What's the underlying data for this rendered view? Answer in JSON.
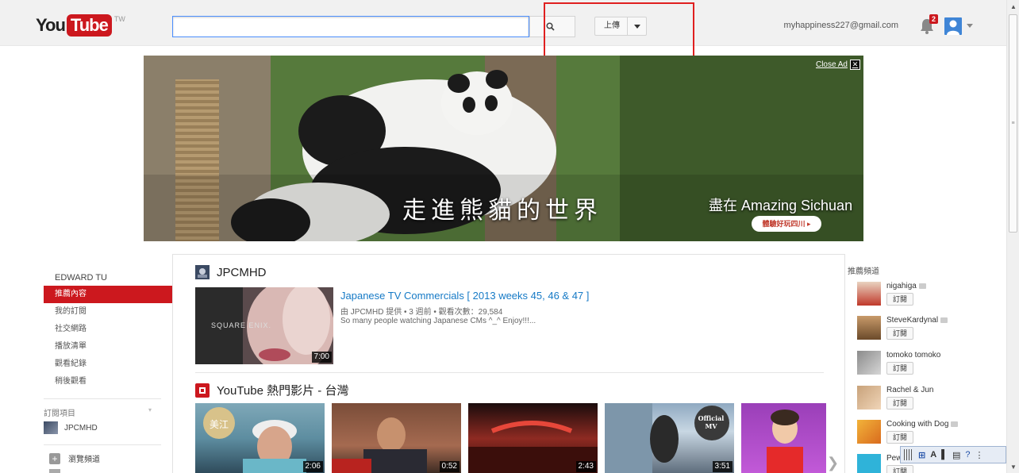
{
  "header": {
    "logo_you": "You",
    "logo_tube": "Tube",
    "logo_region": "TW",
    "search_value": "",
    "upload_label": "上傳",
    "account_email": "myhappiness227@gmail.com",
    "notification_count": "2"
  },
  "ad": {
    "close_label": "Close Ad",
    "headline": "走進熊貓的世界",
    "tagline": "盡在 Amazing Sichuan",
    "cta": "體驗好玩四川 ▸"
  },
  "guide": {
    "user_name": "EDWARD TU",
    "items": [
      {
        "label": "推薦內容"
      },
      {
        "label": "我的訂閱"
      },
      {
        "label": "社交網路"
      },
      {
        "label": "播放清單"
      },
      {
        "label": "觀看紀錄"
      },
      {
        "label": "稍後觀看"
      }
    ],
    "subscriptions_title": "訂閱項目",
    "subscription_channel": "JPCMHD",
    "browse_channels": "瀏覽頻道"
  },
  "feed": {
    "section1_title": "JPCMHD",
    "video": {
      "brand": "SQUARE ENIX.",
      "duration": "7:00",
      "title": "Japanese TV Commercials [ 2013 weeks 45, 46 & 47 ]",
      "meta": "由 JPCMHD 提供 • 3 週前 • 觀看次數：29,584",
      "description": "So many people watching Japanese CMs ^_^ Enjoy!!!..."
    },
    "section2_title": "YouTube 熱門影片 - 台灣",
    "shelf": [
      {
        "duration": "2:06",
        "caption": "美江"
      },
      {
        "duration": "0:52",
        "caption": ""
      },
      {
        "duration": "2:43",
        "caption": ""
      },
      {
        "duration": "3:51",
        "caption": "Official MV"
      },
      {
        "duration": "",
        "caption": ""
      }
    ]
  },
  "rail": {
    "title": "推薦頻道",
    "subscribe_label": "訂閱",
    "channels": [
      {
        "name": "nigahiga"
      },
      {
        "name": "SteveKardynal"
      },
      {
        "name": "tomoko tomoko"
      },
      {
        "name": "Rachel & Jun"
      },
      {
        "name": "Cooking with Dog"
      },
      {
        "name": "Pew"
      }
    ]
  },
  "colors": {
    "brand_red": "#cc181e",
    "link_blue": "#167ac6",
    "highlight_box": "#e02020"
  }
}
